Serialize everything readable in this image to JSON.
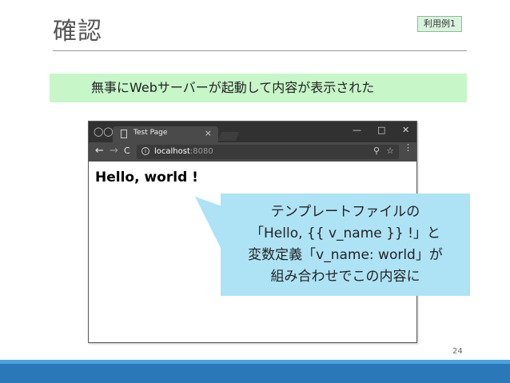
{
  "slide": {
    "title": "確認",
    "tag": "利用例1",
    "banner": "無事にWebサーバーが起動して内容が表示された",
    "page_number": "24"
  },
  "browser": {
    "tab_title": "Test Page",
    "tab_close": "×",
    "window_controls": {
      "minimize": "—",
      "maximize": "□",
      "close": "✕"
    },
    "nav": {
      "back": "←",
      "forward": "→",
      "reload": "C"
    },
    "url": {
      "host": "localhost",
      "port": ":8080"
    },
    "page_heading": "Hello, world !"
  },
  "callout": {
    "lines": [
      "テンプレートファイルの",
      "「Hello, {{ v_name }} !」と",
      "変数定義「v_name: world」が",
      "組み合わせでこの内容に"
    ]
  },
  "icons": [
    "incognito-icon",
    "document-icon",
    "info-icon",
    "zoom-icon",
    "star-icon",
    "menu-icon"
  ],
  "colors": {
    "banner_bg": "#c7f7c9",
    "callout_bg": "#aee3f6",
    "footer": "#2b78b8",
    "browser_chrome": "#313131"
  }
}
